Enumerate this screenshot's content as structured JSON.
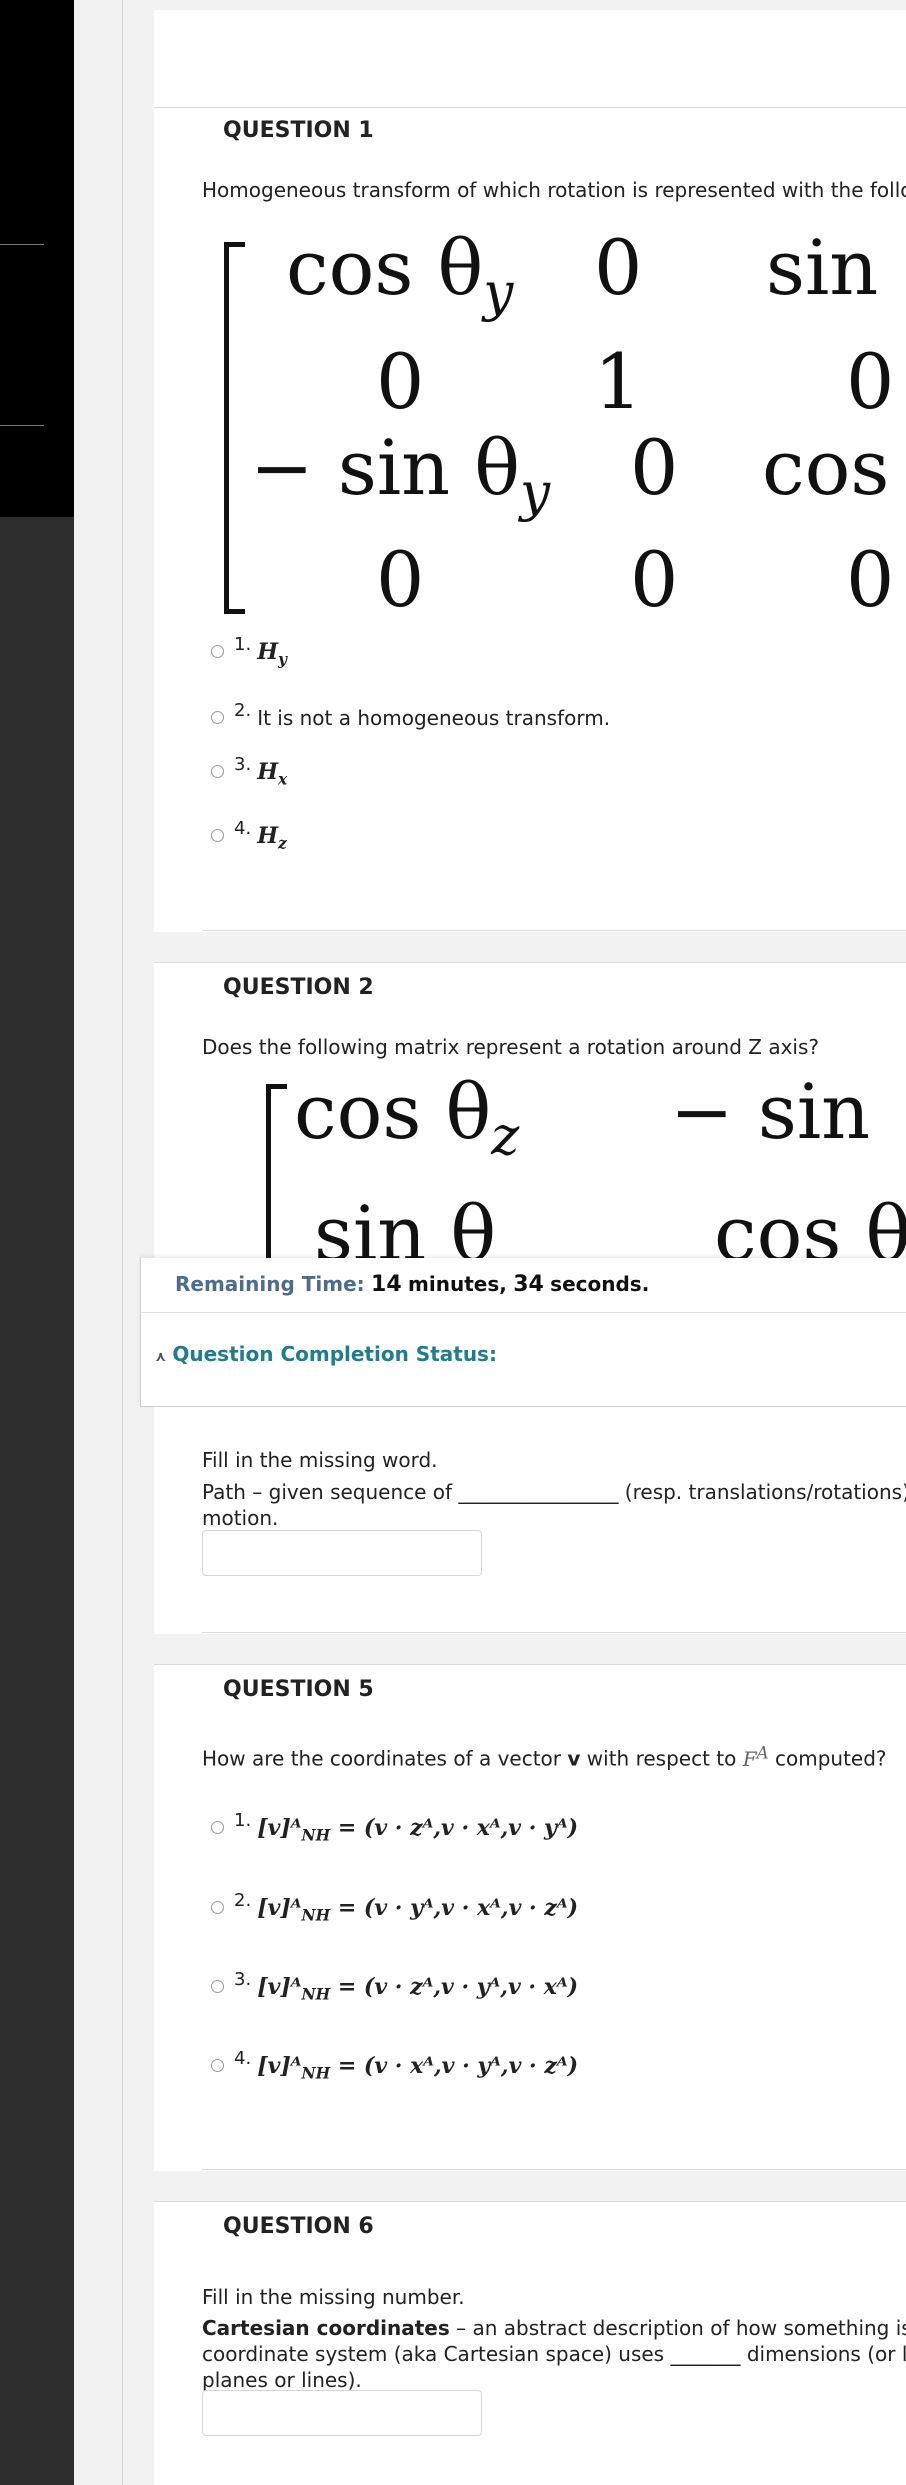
{
  "q1": {
    "title": "QUESTION 1",
    "prompt": "Homogeneous transform of which rotation is represented with the follow",
    "matrix": {
      "r1c1": "cos θ",
      "r1c1_sub": "y",
      "r1c2": "0",
      "r1c3": "sin θ",
      "r2c1": "0",
      "r2c2": "1",
      "r2c3": "0",
      "r3c1": "− sin θ",
      "r3c1_sub": "y",
      "r3c2": "0",
      "r3c3": "cos θ",
      "r4c1": "0",
      "r4c2": "0",
      "r4c3": "0"
    },
    "options": [
      {
        "num": "1.",
        "label": "H",
        "sub": "y",
        "is_math": true
      },
      {
        "num": "2.",
        "label": "It is not a homogeneous transform.",
        "is_math": false
      },
      {
        "num": "3.",
        "label": "H",
        "sub": "x",
        "is_math": true
      },
      {
        "num": "4.",
        "label": "H",
        "sub": "z",
        "is_math": true
      }
    ]
  },
  "q2": {
    "title": "QUESTION 2",
    "prompt": "Does the following matrix represent a rotation around Z axis?",
    "matrix": {
      "r1c1": "cos θ",
      "r1c1_sub": "z",
      "r1c2": "− sin",
      "r2c1": "sin θ",
      "r2c2": "cos θ"
    }
  },
  "status": {
    "remaining_label": "Remaining Time:",
    "minutes_value": "14",
    "minutes_unit": "minutes,",
    "seconds_value": "34",
    "seconds_unit": "seconds.",
    "completion_label": "Question Completion Status:"
  },
  "q4": {
    "instruction": "Fill in the missing word.",
    "sentence_part1": "Path – given sequence of ________________ (resp. translations/rotations) to",
    "sentence_part2": "motion."
  },
  "q5": {
    "title": "QUESTION 5",
    "prompt_before": "How are the coordinates of a vector",
    "prompt_vector": "v",
    "prompt_mid": "with respect to",
    "prompt_frame": "F",
    "prompt_frame_sup": "A",
    "prompt_after": "computed?",
    "options": [
      {
        "num": "1.",
        "formula": "[v]ᴬ",
        "sub": "NH",
        "rhs": "= (v · zᴬ,v · xᴬ,v · yᴬ)"
      },
      {
        "num": "2.",
        "formula": "[v]ᴬ",
        "sub": "NH",
        "rhs": "= (v · yᴬ,v · xᴬ,v · zᴬ)"
      },
      {
        "num": "3.",
        "formula": "[v]ᴬ",
        "sub": "NH",
        "rhs": "= (v · zᴬ,v · yᴬ,v · xᴬ)"
      },
      {
        "num": "4.",
        "formula": "[v]ᴬ",
        "sub": "NH",
        "rhs": "= (v · xᴬ,v · yᴬ,v · zᴬ)"
      }
    ]
  },
  "q6": {
    "title": "QUESTION 6",
    "instruction": "Fill in the missing number.",
    "term": "Cartesian coordinates",
    "line1_rest": " – an abstract description of how something is loc",
    "line2": "coordinate system (aka Cartesian space) uses _______ dimensions (or less",
    "line3": "planes or lines)."
  }
}
